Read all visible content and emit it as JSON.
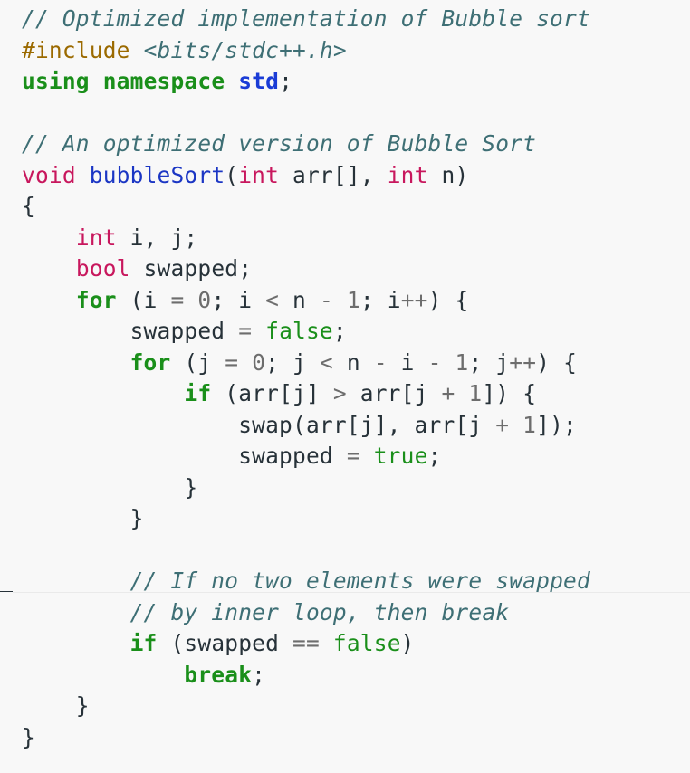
{
  "code": {
    "language": "C++",
    "lines": [
      [
        [
          "comment",
          "// Optimized implementation of Bubble sort"
        ]
      ],
      [
        [
          "preproc",
          "#include "
        ],
        [
          "header",
          "<bits/stdc++.h>"
        ]
      ],
      [
        [
          "kw",
          "using"
        ],
        [
          "plain",
          " "
        ],
        [
          "kw",
          "namespace"
        ],
        [
          "plain",
          " "
        ],
        [
          "ns",
          "std"
        ],
        [
          "plain",
          ";"
        ]
      ],
      [],
      [
        [
          "comment",
          "// An optimized version of Bubble Sort"
        ]
      ],
      [
        [
          "type",
          "void"
        ],
        [
          "plain",
          " "
        ],
        [
          "fn",
          "bubbleSort"
        ],
        [
          "plain",
          "("
        ],
        [
          "type",
          "int"
        ],
        [
          "plain",
          " arr[], "
        ],
        [
          "type",
          "int"
        ],
        [
          "plain",
          " n)"
        ]
      ],
      [
        [
          "plain",
          "{"
        ]
      ],
      [
        [
          "plain",
          "    "
        ],
        [
          "type",
          "int"
        ],
        [
          "plain",
          " i, j;"
        ]
      ],
      [
        [
          "plain",
          "    "
        ],
        [
          "type",
          "bool"
        ],
        [
          "plain",
          " swapped;"
        ]
      ],
      [
        [
          "plain",
          "    "
        ],
        [
          "kw",
          "for"
        ],
        [
          "plain",
          " (i "
        ],
        [
          "op",
          "="
        ],
        [
          "plain",
          " "
        ],
        [
          "num",
          "0"
        ],
        [
          "plain",
          "; i "
        ],
        [
          "op",
          "<"
        ],
        [
          "plain",
          " n "
        ],
        [
          "op",
          "-"
        ],
        [
          "plain",
          " "
        ],
        [
          "num",
          "1"
        ],
        [
          "plain",
          "; i"
        ],
        [
          "op",
          "++"
        ],
        [
          "plain",
          ") {"
        ]
      ],
      [
        [
          "plain",
          "        swapped "
        ],
        [
          "op",
          "="
        ],
        [
          "plain",
          " "
        ],
        [
          "lit",
          "false"
        ],
        [
          "plain",
          ";"
        ]
      ],
      [
        [
          "plain",
          "        "
        ],
        [
          "kw",
          "for"
        ],
        [
          "plain",
          " (j "
        ],
        [
          "op",
          "="
        ],
        [
          "plain",
          " "
        ],
        [
          "num",
          "0"
        ],
        [
          "plain",
          "; j "
        ],
        [
          "op",
          "<"
        ],
        [
          "plain",
          " n "
        ],
        [
          "op",
          "-"
        ],
        [
          "plain",
          " i "
        ],
        [
          "op",
          "-"
        ],
        [
          "plain",
          " "
        ],
        [
          "num",
          "1"
        ],
        [
          "plain",
          "; j"
        ],
        [
          "op",
          "++"
        ],
        [
          "plain",
          ") {"
        ]
      ],
      [
        [
          "plain",
          "            "
        ],
        [
          "kw",
          "if"
        ],
        [
          "plain",
          " (arr[j] "
        ],
        [
          "op",
          ">"
        ],
        [
          "plain",
          " arr[j "
        ],
        [
          "op",
          "+"
        ],
        [
          "plain",
          " "
        ],
        [
          "num",
          "1"
        ],
        [
          "plain",
          "]) {"
        ]
      ],
      [
        [
          "plain",
          "                swap(arr[j], arr[j "
        ],
        [
          "op",
          "+"
        ],
        [
          "plain",
          " "
        ],
        [
          "num",
          "1"
        ],
        [
          "plain",
          "]);"
        ]
      ],
      [
        [
          "plain",
          "                swapped "
        ],
        [
          "op",
          "="
        ],
        [
          "plain",
          " "
        ],
        [
          "lit",
          "true"
        ],
        [
          "plain",
          ";"
        ]
      ],
      [
        [
          "plain",
          "            }"
        ]
      ],
      [
        [
          "plain",
          "        }"
        ]
      ],
      [],
      [
        [
          "plain",
          "        "
        ],
        [
          "comment",
          "// If no two elements were swapped"
        ]
      ],
      [
        [
          "plain",
          "        "
        ],
        [
          "comment",
          "// by inner loop, then break"
        ]
      ],
      [
        [
          "plain",
          "        "
        ],
        [
          "kw",
          "if"
        ],
        [
          "plain",
          " (swapped "
        ],
        [
          "op",
          "=="
        ],
        [
          "plain",
          " "
        ],
        [
          "lit",
          "false"
        ],
        [
          "plain",
          ")"
        ]
      ],
      [
        [
          "plain",
          "            "
        ],
        [
          "kw",
          "break"
        ],
        [
          "plain",
          ";"
        ]
      ],
      [
        [
          "plain",
          "    }"
        ]
      ],
      [
        [
          "plain",
          "}"
        ]
      ]
    ]
  }
}
